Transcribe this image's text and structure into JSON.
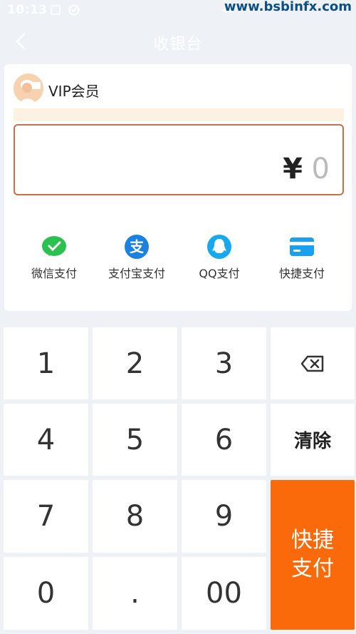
{
  "status_bar": {
    "time": "10:13",
    "watermark": "www.bsbinfx.com"
  },
  "nav": {
    "title": "收银台"
  },
  "member": {
    "label": "VIP会员"
  },
  "amount": {
    "currency": "¥",
    "value": "0"
  },
  "payment_methods": [
    {
      "label": "微信支付",
      "icon": "wechat-pay-icon",
      "color": "#2ac14f"
    },
    {
      "label": "支付宝支付",
      "icon": "alipay-icon",
      "color": "#1a82e0"
    },
    {
      "label": "QQ支付",
      "icon": "qq-pay-icon",
      "color": "#17a9f0"
    },
    {
      "label": "快捷支付",
      "icon": "card-pay-icon",
      "color": "#1aa0f0"
    }
  ],
  "keypad": {
    "keys": [
      "1",
      "2",
      "3",
      "4",
      "5",
      "6",
      "7",
      "8",
      "9",
      "0",
      ".",
      "00"
    ],
    "clear_label": "清除",
    "pay_label_line1": "快捷",
    "pay_label_line2": "支付"
  },
  "colors": {
    "accent": "#fa6a0a",
    "header_bg": "#eef1f5",
    "amount_border": "#c77045"
  }
}
